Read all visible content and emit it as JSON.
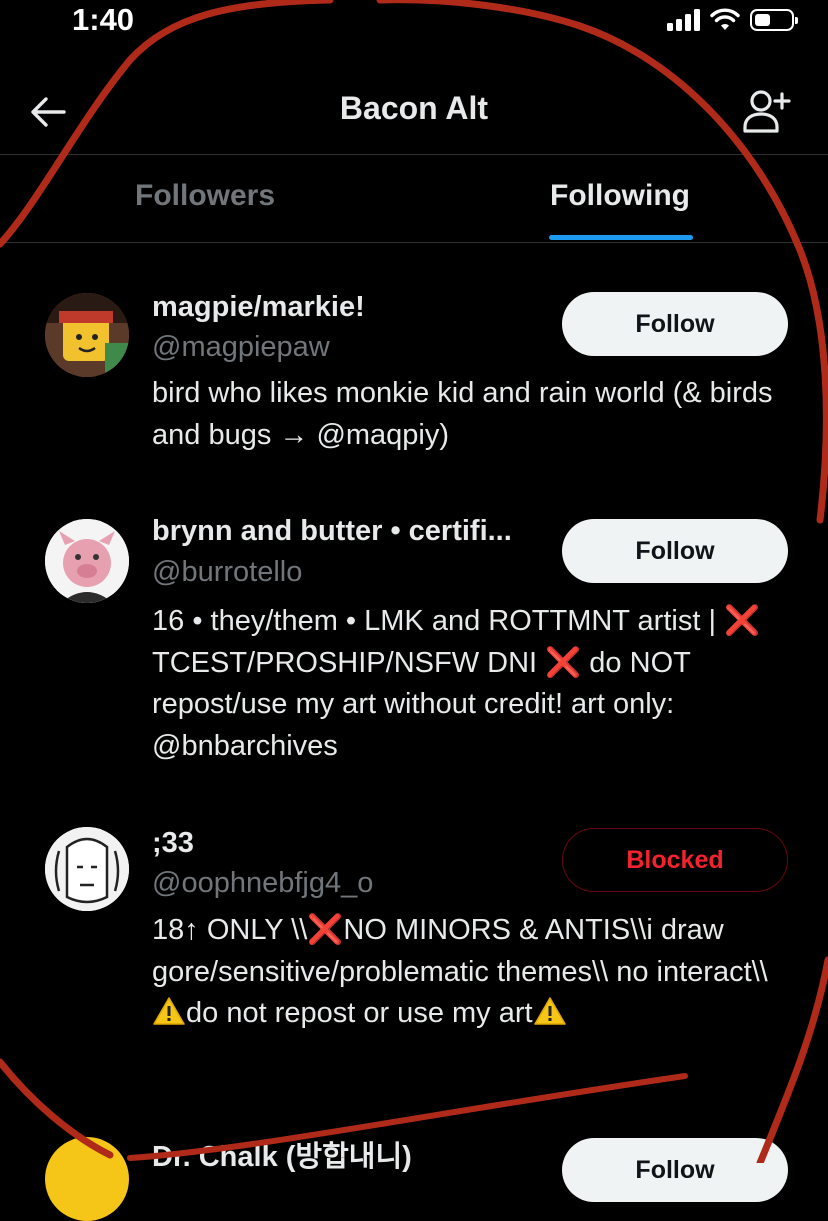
{
  "status_bar": {
    "time": "1:40",
    "battery_level_percent": 45
  },
  "header": {
    "title": "Bacon Alt",
    "back_icon": "arrow-left-icon",
    "action_icon": "add-user-icon"
  },
  "tabs": [
    {
      "label": "Followers",
      "active": false
    },
    {
      "label": "Following",
      "active": true
    }
  ],
  "accent_color": "#1d9bf0",
  "users": [
    {
      "name": "magpie/markie!",
      "handle": "@magpiepaw",
      "bio": "bird who likes monkie kid and rain world (& birds and bugs → @maqpiy)",
      "button": "Follow"
    },
    {
      "name": "brynn and butter • certifi...",
      "handle": "@burrotello",
      "bio_parts": {
        "p1": "16 • they/them • LMK and ROTTMNT artist |",
        "x1": "❌",
        "p2": " TCEST/PROSHIP/NSFW DNI ",
        "x2": "❌",
        "p3": " do NOT repost/use my art without credit! art only: @bnbarchives"
      },
      "button": "Follow"
    },
    {
      "name": ";33",
      "handle": "@oophnebfjg4_o",
      "bio_parts": {
        "p1": "18↑ ONLY \\\\",
        "x1": "❌",
        "p2": "NO MINORS & ANTIS\\\\i draw gore/sensitive/problematic themes\\\\ no interact\\\\",
        "p3": "do not repost or use my art"
      },
      "button": "Blocked"
    },
    {
      "name": "Dr. Chalk (방합내니)",
      "button": "Follow"
    }
  ]
}
